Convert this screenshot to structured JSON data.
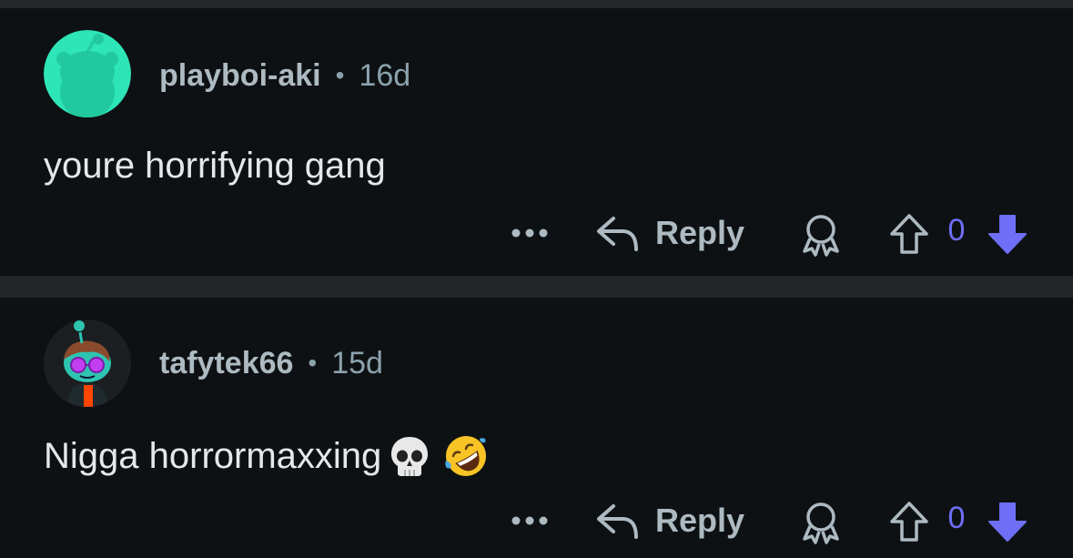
{
  "comments": [
    {
      "username": "playboi-aki",
      "separator": "•",
      "age": "16d",
      "text": "youre horrifying gang",
      "emojis": [],
      "reply_label": "Reply",
      "score": "0",
      "avatar": "green-snoo-avatar"
    },
    {
      "username": "tafytek66",
      "separator": "•",
      "age": "15d",
      "text": "Nigga horrormaxxing",
      "emojis": [
        "skull-emoji",
        "rolling-on-floor-laughing-emoji"
      ],
      "reply_label": "Reply",
      "score": "0",
      "avatar": "custom-snoo-avatar"
    }
  ],
  "colors": {
    "background": "#0e1113",
    "divider": "#242729",
    "username": "#adbac2",
    "meta": "#8ba2ad",
    "text": "#e3e8ea",
    "vote_active": "#6e6ef7"
  },
  "icons": [
    "more-icon",
    "reply-icon",
    "award-icon",
    "upvote-icon",
    "downvote-icon"
  ]
}
